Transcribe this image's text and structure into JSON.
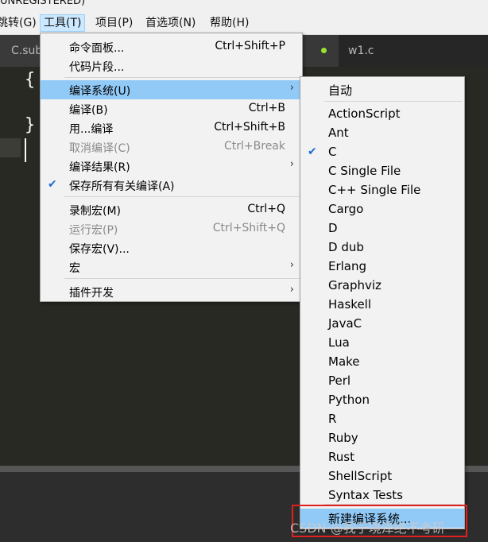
{
  "window": {
    "title_fragment": "UNREGISTERED)"
  },
  "menubar": {
    "items": [
      "跳转(G)",
      "工具(T)",
      "项目(P)",
      "首选项(N)",
      "帮助(H)"
    ]
  },
  "tabs": [
    "C.sub",
    "w1.c"
  ],
  "editor": {
    "brace_open": "{",
    "brace_close": "}"
  },
  "tools_menu": {
    "items": [
      {
        "label": "命令面板...",
        "shortcut": "Ctrl+Shift+P"
      },
      {
        "label": "代码片段..."
      },
      {
        "label": "编译系统(U)",
        "submenu": true,
        "highlighted": true
      },
      {
        "label": "编译(B)",
        "shortcut": "Ctrl+B"
      },
      {
        "label": "用...编译",
        "shortcut": "Ctrl+Shift+B"
      },
      {
        "label": "取消编译(C)",
        "shortcut": "Ctrl+Break",
        "disabled": true
      },
      {
        "label": "编译结果(R)",
        "submenu": true
      },
      {
        "label": "保存所有有关编译(A)",
        "checked": true
      },
      {
        "label": "录制宏(M)",
        "shortcut": "Ctrl+Q"
      },
      {
        "label": "运行宏(P)",
        "shortcut": "Ctrl+Shift+Q",
        "disabled": true
      },
      {
        "label": "保存宏(V)..."
      },
      {
        "label": "宏",
        "submenu": true
      },
      {
        "label": "插件开发",
        "submenu": true
      }
    ]
  },
  "build_system_menu": {
    "auto": "自动",
    "items": [
      "ActionScript",
      "Ant",
      "C",
      "C Single File",
      "C++ Single File",
      "Cargo",
      "D",
      "D dub",
      "Erlang",
      "Graphviz",
      "Haskell",
      "JavaC",
      "Lua",
      "Make",
      "Perl",
      "Python",
      "R",
      "Ruby",
      "Rust",
      "ShellScript",
      "Syntax Tests"
    ],
    "checked": "C",
    "new_build_system": "新建编译系统..."
  },
  "watermark": "CSDN @我于境泽绝不考研",
  "colors": {
    "highlight": "#91c9f7",
    "check": "#1e6bd6",
    "annotation_box": "#e02020"
  }
}
